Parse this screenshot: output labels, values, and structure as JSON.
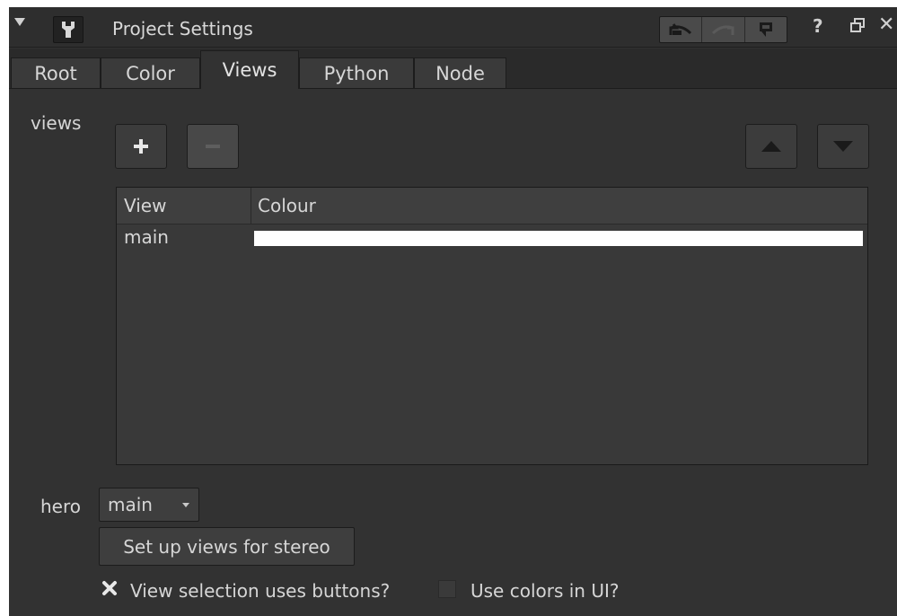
{
  "window": {
    "title": "Project Settings"
  },
  "tabs": [
    {
      "label": "Root"
    },
    {
      "label": "Color"
    },
    {
      "label": "Views"
    },
    {
      "label": "Python"
    },
    {
      "label": "Node"
    }
  ],
  "active_tab": "Views",
  "views_section": {
    "label": "views",
    "add_label": "+",
    "remove_label": "−",
    "table": {
      "columns": [
        "View",
        "Colour"
      ],
      "rows": [
        {
          "view": "main",
          "colour": "#ffffff"
        }
      ]
    }
  },
  "hero": {
    "label": "hero",
    "selected": "main"
  },
  "stereo_button": {
    "label": "Set up views for stereo"
  },
  "options": {
    "view_selection_buttons": {
      "label": "View selection uses buttons?",
      "checked": true
    },
    "use_colors_ui": {
      "label": "Use colors in UI?",
      "checked": false
    }
  },
  "colors": {
    "panel_bg": "#323232",
    "swatch": "#ffffff"
  }
}
